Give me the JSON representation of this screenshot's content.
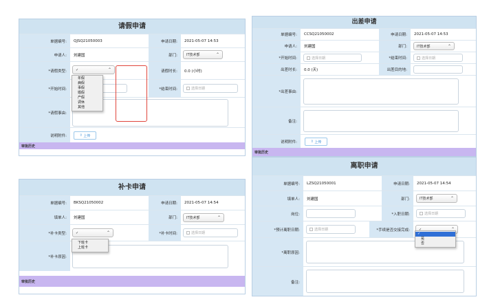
{
  "leave": {
    "title": "请假申请",
    "doc_no_label": "单据编号:",
    "doc_no": "QJSQ21050003",
    "apply_date_label": "申请日期:",
    "apply_date": "2021-05-07 14:53",
    "applicant_label": "申请人:",
    "applicant": "刘建国",
    "dept_label": "部门:",
    "dept": "IT技术部",
    "type_label": "*请假类型:",
    "type_value": "✓",
    "duration_label": "请假时长:",
    "duration": "0.0 (小时)",
    "start_label": "*开始时间:",
    "end_label": "*结束时间:",
    "end_placeholder": "选择日期",
    "reason_label": "*请假事由:",
    "attach_label": "说明附件:",
    "upload": "上传",
    "history": "审批历史",
    "type_options": [
      "年假",
      "病假",
      "事假",
      "婚假",
      "产假",
      "调休",
      "其他"
    ]
  },
  "trip": {
    "title": "出差申请",
    "doc_no_label": "单据编号:",
    "doc_no": "CCSQ21050002",
    "apply_date_label": "申请日期:",
    "apply_date": "2021-05-07 14:53",
    "applicant_label": "申请人:",
    "applicant": "刘建国",
    "dept_label": "部门:",
    "dept": "IT技术部",
    "start_label": "*开始时间:",
    "start_placeholder": "选择日期",
    "end_label": "*结束时间:",
    "end_placeholder": "选择日期",
    "duration_label": "出差时长:",
    "duration": "0.0 (天)",
    "dest_label": "出差目的地:",
    "reason_label": "*出差事由:",
    "remark_label": "备注:",
    "attach_label": "说明附件:",
    "upload": "上传",
    "history": "审批历史"
  },
  "card": {
    "title": "补卡申请",
    "doc_no_label": "单据编号:",
    "doc_no": "BKSQ21050002",
    "apply_date_label": "申请日期:",
    "apply_date": "2021-05-07 14:54",
    "applicant_label": "填单人:",
    "applicant": "刘建国",
    "dept_label": "部门:",
    "dept": "IT技术部",
    "type_label": "*补卡类型:",
    "type_value": "✓",
    "time_label": "*补卡时间:",
    "time_placeholder": "选择日期",
    "reason_label": "*补卡原因:",
    "history": "审批历史",
    "type_options": [
      "下班卡",
      "上班卡"
    ]
  },
  "resign": {
    "title": "离职申请",
    "doc_no_label": "单据编号:",
    "doc_no": "LZSQ21050001",
    "apply_date_label": "申请日期:",
    "apply_date": "2021-05-07 14:54",
    "applicant_label": "填单人:",
    "applicant": "刘建国",
    "dept_label": "部门:",
    "dept": "IT技术部",
    "position_label": "岗位:",
    "join_label": "*入职日期:",
    "join_placeholder": "选择日期",
    "leave_date_label": "*预计离职日期:",
    "leave_date_placeholder": "选择日期",
    "handover_label": "*手续是否交接完成:",
    "handover_value": "✓",
    "reason_label": "*离职原因:",
    "remark_label": "备注:",
    "handover_options": [
      "是",
      "否"
    ]
  }
}
